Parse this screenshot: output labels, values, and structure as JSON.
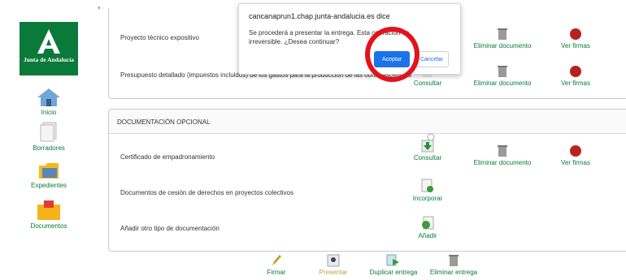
{
  "sidebar": {
    "logo_text": "Junta de Andalucía",
    "items": [
      {
        "label": "Inicio",
        "icon": "home-icon"
      },
      {
        "label": "Borradores",
        "icon": "drafts-icon"
      },
      {
        "label": "Expedientes",
        "icon": "folder-icon"
      },
      {
        "label": "Documentos",
        "icon": "documents-icon"
      }
    ]
  },
  "top_panel": {
    "rows": [
      {
        "label": "Proyecto técnico expositivo",
        "actions": [
          "Eliminar documento",
          "Ver firmas"
        ]
      },
      {
        "label": "Presupuesto detallado (impuestos incluidos) de los gastos para la producción de las obras escénicas",
        "actions": [
          "Consultar",
          "Eliminar documento",
          "Ver firmas"
        ]
      }
    ]
  },
  "optional_panel": {
    "header": "DOCUMENTACIÓN OPCIONAL",
    "rows": [
      {
        "label": "Certificado de empadronamiento",
        "actions": [
          "Consultar",
          "Eliminar documento",
          "Ver firmas"
        ]
      },
      {
        "label": "Documentos de cesión de derechos en proyectos colectivos",
        "actions": [
          "Incorporar"
        ]
      },
      {
        "label": "Añadir otro tipo de documentación",
        "actions": [
          "Añadir"
        ]
      }
    ]
  },
  "toolbar": {
    "firmar": "Firmar",
    "presentar": "Presentar",
    "duplicar": "Duplicar entrega",
    "eliminar": "Eliminar entrega"
  },
  "dialog": {
    "title": "cancanaprun1.chap.junta-andalucia.es dice",
    "message": "Se procederá a presentar la entrega. Esta operación es irreversible. ¿Desea continuar?",
    "accept": "Aceptar",
    "cancel": "Cancelar"
  },
  "colors": {
    "brand_green": "#0a7a3a",
    "accept_blue": "#1a73e8",
    "highlight_red": "#e3131b"
  }
}
